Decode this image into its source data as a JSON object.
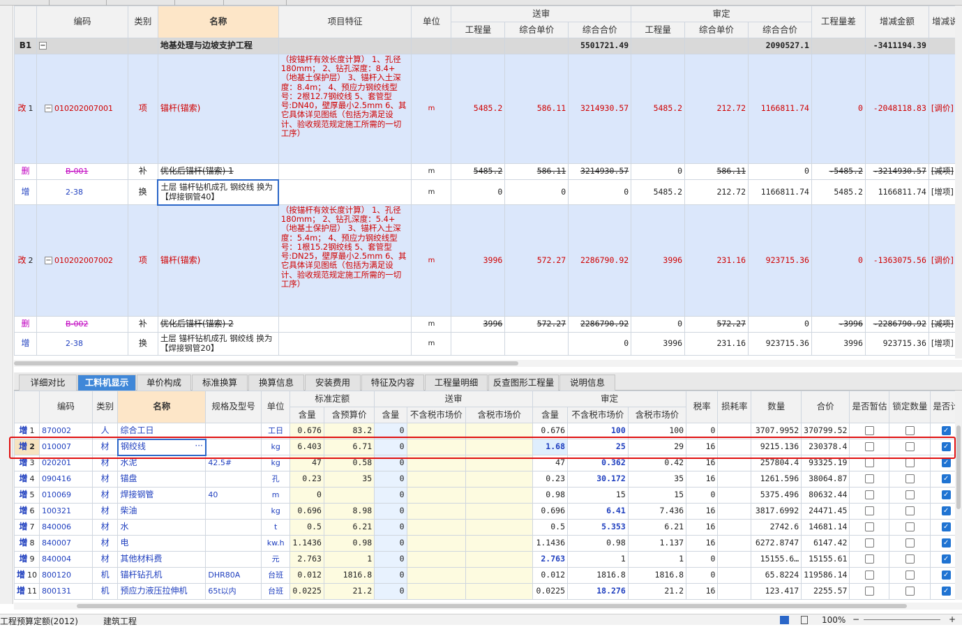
{
  "upper": {
    "headers": {
      "code": "编码",
      "type": "类别",
      "name": "名称",
      "feature": "项目特征",
      "unit": "单位",
      "send": "送审",
      "approve": "审定",
      "qty": "工程量",
      "uprice": "综合单价",
      "total": "综合合价",
      "qtydiff": "工程量差",
      "amtdiff": "增减金额",
      "amtnote": "增减说"
    },
    "b1": {
      "mark": "B1",
      "name": "地基处理与边坡支护工程",
      "send_total": "5501721.49",
      "approve_total": "2090527.1",
      "diff": "-3411194.39"
    },
    "rows": [
      {
        "mark": "改",
        "idx": "1",
        "code": "010202007001",
        "type": "项",
        "name": "锚杆(锚索)",
        "feature": "（按锚杆有效长度计算）\n1、孔径180mm；\n2、钻孔深度：8.4+（地基土保护层）\n3、锚杆入土深度：8.4m；\n4、预应力钢绞线型号：2根12.7钢绞线\n5、套管型号:DN40，壁厚最小2.5mm\n6、其它具体详见图纸（包括为满足设计、验收规范规定施工所需的一切工序）",
        "unit": "m",
        "sq": "5485.2",
        "sp": "586.11",
        "st": "3214930.57",
        "aq": "5485.2",
        "ap": "212.72",
        "at": "1166811.74",
        "qd": "0",
        "ad": "-2048118.83",
        "note": "[调价]"
      },
      {
        "mark": "删",
        "idx": "",
        "code": "B-001",
        "type": "补",
        "name": "优化后锚杆(锚索) 1",
        "unit": "m",
        "sq": "5485.2",
        "sp": "586.11",
        "st": "3214930.57",
        "aq": "0",
        "ap": "586.11",
        "at": "0",
        "qd": "-5485.2",
        "ad": "-3214930.57",
        "note": "[减项]"
      },
      {
        "mark": "增",
        "idx": "",
        "code": "2-38",
        "type": "换",
        "name": "土层 锚杆钻机成孔 钢绞线  换为【焊接钢管40】",
        "unit": "m",
        "sq": "0",
        "sp": "0",
        "st": "0",
        "aq": "5485.2",
        "ap": "212.72",
        "at": "1166811.74",
        "qd": "5485.2",
        "ad": "1166811.74",
        "note": "[增项]"
      },
      {
        "mark": "改",
        "idx": "2",
        "code": "010202007002",
        "type": "项",
        "name": "锚杆(锚索)",
        "feature": "（按锚杆有效长度计算）\n1、孔径180mm；\n2、钻孔深度：5.4+（地基土保护层）\n3、锚杆入土深度：5.4m；\n4、预应力钢绞线型号：1根15.2钢绞线\n5、套管型号:DN25，壁厚最小2.5mm\n6、其它具体详见图纸（包括为满足设计、验收规范规定施工所需的一切工序）",
        "unit": "m",
        "sq": "3996",
        "sp": "572.27",
        "st": "2286790.92",
        "aq": "3996",
        "ap": "231.16",
        "at": "923715.36",
        "qd": "0",
        "ad": "-1363075.56",
        "note": "[调价]"
      },
      {
        "mark": "删",
        "idx": "",
        "code": "B-002",
        "type": "补",
        "name": "优化后锚杆(锚索) 2",
        "unit": "m",
        "sq": "3996",
        "sp": "572.27",
        "st": "2286790.92",
        "aq": "0",
        "ap": "572.27",
        "at": "0",
        "qd": "-3996",
        "ad": "-2286790.92",
        "note": "[减项]"
      },
      {
        "mark": "增",
        "idx": "",
        "code": "2-38",
        "type": "换",
        "name": "土层 锚杆钻机成孔 钢绞线 换为【焊接钢管20】",
        "unit": "m",
        "sq": "",
        "sp": "",
        "st": "0",
        "aq": "3996",
        "ap": "231.16",
        "at": "923715.36",
        "qd": "3996",
        "ad": "923715.36",
        "note": "[增项]"
      }
    ]
  },
  "tabs": [
    "详细对比",
    "工料机显示",
    "单价构成",
    "标准换算",
    "换算信息",
    "安装费用",
    "特征及内容",
    "工程量明细",
    "反查图形工程量",
    "说明信息"
  ],
  "active_tab": "工料机显示",
  "lower": {
    "headers": {
      "code": "编码",
      "type": "类别",
      "name": "名称",
      "spec": "规格及型号",
      "unit": "单位",
      "std": "标准定额",
      "content": "含量",
      "budget": "含预算价",
      "send": "送审",
      "exmkt": "不含税市场价",
      "inmkt": "含税市场价",
      "approve": "审定",
      "tax": "税率",
      "loss": "损耗率",
      "qty": "数量",
      "total": "合价",
      "temp": "是否暂估",
      "lock": "锁定数量",
      "calc": "是否计"
    },
    "rows": [
      {
        "mark": "增",
        "idx": "1",
        "code": "870002",
        "type": "人",
        "name": "综合工日",
        "spec": "",
        "unit": "工日",
        "sc": "0.676",
        "sb": "83.2",
        "dc": "0",
        "dex": "",
        "din": "",
        "ac": "0.676",
        "aex": "100",
        "ain": "100",
        "tax": "0",
        "loss": "",
        "qty": "3707.9952",
        "total": "370799.52",
        "temp": false,
        "lock": false,
        "calc": true
      },
      {
        "mark": "增",
        "idx": "2",
        "code": "010007",
        "type": "材",
        "name": "钢绞线",
        "spec": "",
        "unit": "kg",
        "sc": "6.403",
        "sb": "6.71",
        "dc": "0",
        "dex": "",
        "din": "",
        "ac": "1.68",
        "aex": "25",
        "ain": "29",
        "tax": "16",
        "loss": "",
        "qty": "9215.136",
        "total": "230378.4",
        "temp": false,
        "lock": false,
        "calc": true
      },
      {
        "mark": "增",
        "idx": "3",
        "code": "020201",
        "type": "材",
        "name": "水泥",
        "spec": "42.5#",
        "unit": "kg",
        "sc": "47",
        "sb": "0.58",
        "dc": "0",
        "dex": "",
        "din": "",
        "ac": "47",
        "aex": "0.362",
        "ain": "0.42",
        "tax": "16",
        "loss": "",
        "qty": "257804.4",
        "total": "93325.19",
        "temp": false,
        "lock": false,
        "calc": true
      },
      {
        "mark": "增",
        "idx": "4",
        "code": "090416",
        "type": "材",
        "name": "锚盘",
        "spec": "",
        "unit": "孔",
        "sc": "0.23",
        "sb": "35",
        "dc": "0",
        "dex": "",
        "din": "",
        "ac": "0.23",
        "aex": "30.172",
        "ain": "35",
        "tax": "16",
        "loss": "",
        "qty": "1261.596",
        "total": "38064.87",
        "temp": false,
        "lock": false,
        "calc": true
      },
      {
        "mark": "增",
        "idx": "5",
        "code": "010069",
        "type": "材",
        "name": "焊接钢管",
        "spec": "40",
        "unit": "m",
        "sc": "0",
        "sb": "",
        "dc": "0",
        "dex": "",
        "din": "",
        "ac": "0.98",
        "aex": "15",
        "ain": "15",
        "tax": "0",
        "loss": "",
        "qty": "5375.496",
        "total": "80632.44",
        "temp": false,
        "lock": false,
        "calc": true
      },
      {
        "mark": "增",
        "idx": "6",
        "code": "100321",
        "type": "材",
        "name": "柴油",
        "spec": "",
        "unit": "kg",
        "sc": "0.696",
        "sb": "8.98",
        "dc": "0",
        "dex": "",
        "din": "",
        "ac": "0.696",
        "aex": "6.41",
        "ain": "7.436",
        "tax": "16",
        "loss": "",
        "qty": "3817.6992",
        "total": "24471.45",
        "temp": false,
        "lock": false,
        "calc": true
      },
      {
        "mark": "增",
        "idx": "7",
        "code": "840006",
        "type": "材",
        "name": "水",
        "spec": "",
        "unit": "t",
        "sc": "0.5",
        "sb": "6.21",
        "dc": "0",
        "dex": "",
        "din": "",
        "ac": "0.5",
        "aex": "5.353",
        "ain": "6.21",
        "tax": "16",
        "loss": "",
        "qty": "2742.6",
        "total": "14681.14",
        "temp": false,
        "lock": false,
        "calc": true
      },
      {
        "mark": "增",
        "idx": "8",
        "code": "840007",
        "type": "材",
        "name": "电",
        "spec": "",
        "unit": "kw.h",
        "sc": "1.1436",
        "sb": "0.98",
        "dc": "0",
        "dex": "",
        "din": "",
        "ac": "1.1436",
        "aex": "0.98",
        "ain": "1.137",
        "tax": "16",
        "loss": "",
        "qty": "6272.8747",
        "total": "6147.42",
        "temp": false,
        "lock": false,
        "calc": true
      },
      {
        "mark": "增",
        "idx": "9",
        "code": "840004",
        "type": "材",
        "name": "其他材料费",
        "spec": "",
        "unit": "元",
        "sc": "2.763",
        "sb": "1",
        "dc": "0",
        "dex": "",
        "din": "",
        "ac": "2.763",
        "aex": "1",
        "ain": "1",
        "tax": "0",
        "loss": "",
        "qty": "15155.6…",
        "total": "15155.61",
        "temp": false,
        "lock": false,
        "calc": true
      },
      {
        "mark": "增",
        "idx": "10",
        "code": "800120",
        "type": "机",
        "name": "锚杆钻孔机",
        "spec": "DHR80A",
        "unit": "台班",
        "sc": "0.012",
        "sb": "1816.8",
        "dc": "0",
        "dex": "",
        "din": "",
        "ac": "0.012",
        "aex": "1816.8",
        "ain": "1816.8",
        "tax": "0",
        "loss": "",
        "qty": "65.8224",
        "total": "119586.14",
        "temp": false,
        "lock": false,
        "calc": true
      },
      {
        "mark": "增",
        "idx": "11",
        "code": "800131",
        "type": "机",
        "name": "预应力液压拉伸机",
        "spec": "65t以内",
        "unit": "台班",
        "sc": "0.0225",
        "sb": "21.2",
        "dc": "0",
        "dex": "",
        "din": "",
        "ac": "0.0225",
        "aex": "18.276",
        "ain": "21.2",
        "tax": "16",
        "loss": "",
        "qty": "123.417",
        "total": "2255.57",
        "temp": false,
        "lock": false,
        "calc": true
      }
    ]
  },
  "status": {
    "left1": "工程预算定额(2012)",
    "left2": "建筑工程",
    "zoom": "100%"
  },
  "colors": {
    "accent": "#3f87d8",
    "highlight": "#e01010",
    "mod": "#d00000",
    "del": "#c000c0",
    "add": "#1f3fbf"
  }
}
